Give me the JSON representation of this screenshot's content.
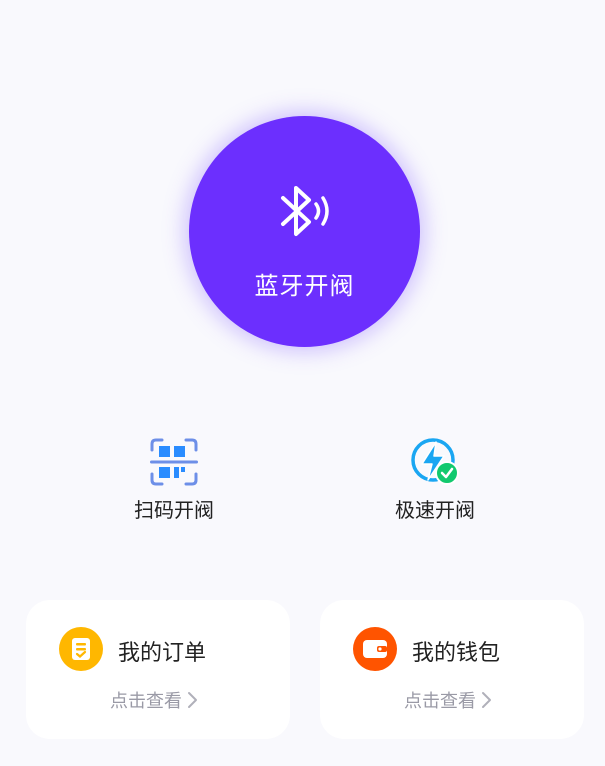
{
  "colors": {
    "primary": "#6c2ffe",
    "background": "#f9f9fd",
    "order_icon_bg": "#ffb700",
    "wallet_icon_bg": "#ff5400",
    "scan_icon": "#2a8cff",
    "fast_icon": "#1aa6f2",
    "fast_check": "#12c96e",
    "muted_text": "#9a9aa6"
  },
  "bluetooth": {
    "icon": "bluetooth-icon",
    "label": "蓝牙开阀"
  },
  "quick_actions": [
    {
      "icon": "qr-scan-icon",
      "label": "扫码开阀"
    },
    {
      "icon": "lightning-check-icon",
      "label": "极速开阀"
    }
  ],
  "cards": [
    {
      "icon": "order-list-icon",
      "title": "我的订单",
      "link": "点击查看"
    },
    {
      "icon": "wallet-icon",
      "title": "我的钱包",
      "link": "点击查看"
    }
  ]
}
